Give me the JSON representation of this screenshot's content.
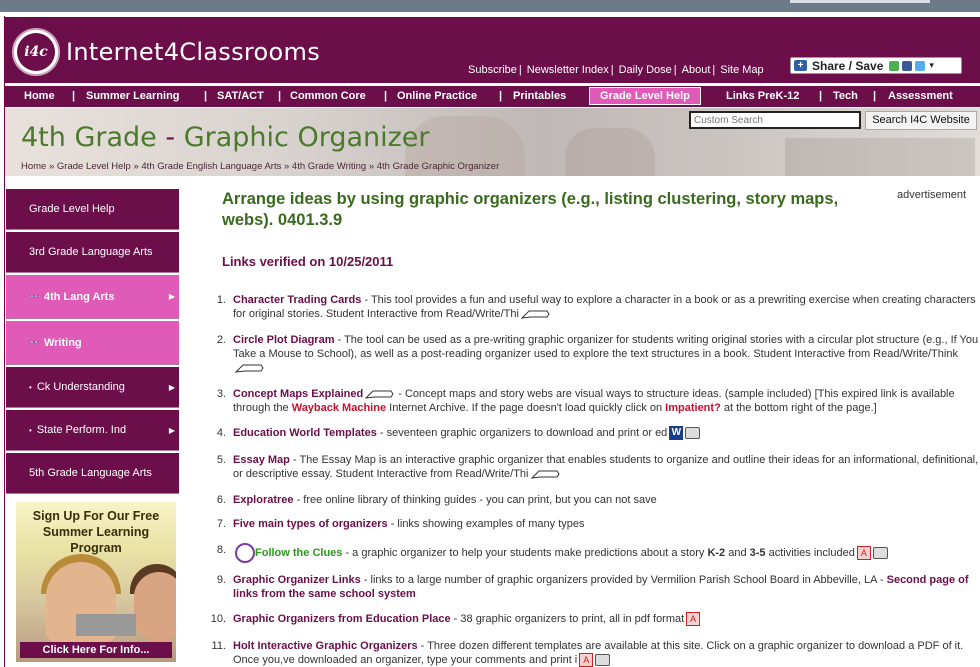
{
  "header": {
    "logo_mark": "i4c",
    "site_name": "Internet4Classrooms",
    "links": [
      "Subscribe",
      "Newsletter Index",
      "Daily Dose",
      "About",
      "Site Map"
    ],
    "share_label": "Share / Save"
  },
  "nav": {
    "items": [
      "Home",
      "Summer Learning",
      "SAT/ACT",
      "Common Core",
      "Online Practice",
      "Printables",
      "Grade Level Help",
      "Links PreK-12",
      "Tech",
      "Assessment"
    ],
    "active": "Grade Level Help"
  },
  "banner": {
    "title_part1": "4th Grade",
    "title_sep": " - ",
    "title_part2": "Graphic Organizer",
    "breadcrumb": "Home » Grade Level Help » 4th Grade English Language Arts » 4th Grade Writing » 4th Grade Graphic Organizer",
    "search_placeholder": "Custom Search",
    "search_button": "Search I4C Website"
  },
  "sidebar": {
    "items": [
      {
        "label": "Grade Level Help",
        "style": "dark"
      },
      {
        "label": "3rd Grade Language Arts",
        "style": "dark"
      },
      {
        "label": "4th Lang Arts",
        "style": "pink"
      },
      {
        "label": "Writing",
        "style": "pink"
      },
      {
        "label": "Ck Understanding",
        "style": "dark"
      },
      {
        "label": "State Perform. Ind",
        "style": "dark"
      },
      {
        "label": "5th Grade Language Arts",
        "style": "dark"
      }
    ],
    "promo_text": "Sign Up For Our Free Summer Learning Program",
    "promo_cta": "Click Here For Info..."
  },
  "main": {
    "heading": "Arrange ideas by using graphic organizers (e.g., listing clustering, story maps, webs). 0401.3.9",
    "verified": "Links verified on 10/25/2011",
    "advertisement": "advertisement"
  },
  "links": [
    {
      "num": "1.",
      "title": "Character Trading Cards",
      "text": " - This tool provides a fun and useful way to explore a character in a book or as a prewriting exercise when creating characters for original stories. Student Interactive from Read/Write/Thi"
    },
    {
      "num": "2.",
      "title": "Circle Plot Diagram",
      "text": " - The tool can be used as a pre-writing graphic organizer for students writing original stories with a circular plot structure (e.g., If You Take a Mouse to School), as well as a post-reading organizer used to explore the text structures in a book. Student Interactive from Read/Write/Think"
    },
    {
      "num": "3.",
      "title": "Concept Maps Explained",
      "text": " - Concept maps and story webs are visual ways to structure ideas. (sample included) [This expired link is available through the ",
      "link2": "Wayback Machine",
      "text2": " Internet Archive. If the page doesn't load quickly click on ",
      "link3": "Impatient?",
      "text3": " at the bottom right of the page.]"
    },
    {
      "num": "4.",
      "title": "Education World Templates",
      "text": " - seventeen graphic organizers to download and print or ed"
    },
    {
      "num": "5.",
      "title": "Essay Map",
      "text": " - The Essay Map is an interactive graphic organizer that enables students to organize and outline their ideas for an informational, definitional, or descriptive essay. Student Interactive from Read/Write/Thi"
    },
    {
      "num": "6.",
      "title": "Exploratree",
      "text": " - free online library of thinking guides - you can print, but you can not save"
    },
    {
      "num": "7.",
      "title": "Five main types of organizers",
      "text": " - links showing examples of many types"
    },
    {
      "num": "8.",
      "title": "Follow the Clues",
      "text": " - a graphic organizer to help your students make predictions about a story ",
      "bold1": "K-2",
      "text2": " and ",
      "bold2": "3-5",
      "text3": " activities included"
    },
    {
      "num": "9.",
      "title": "Graphic Organizer Links",
      "text": " - links to a large number of graphic organizers provided by Vermilion Parish School Board in Abbeville, LA - ",
      "link2": "Second page of links from the same school system"
    },
    {
      "num": "10.",
      "title": "Graphic Organizers from Education Place",
      "text": " - 38 graphic organizers to print, all in pdf format"
    },
    {
      "num": "11.",
      "title": "Holt Interactive Graphic Organizers",
      "text": " - Three dozen different templates are available at this site. Click on a graphic organizer to download a PDF of it. Once you,ve downloaded an organizer, type your comments and print i"
    }
  ],
  "colors": {
    "brand": "#6b0e4a",
    "accent": "#e05bb8",
    "heading_green": "#3a6a1e"
  }
}
